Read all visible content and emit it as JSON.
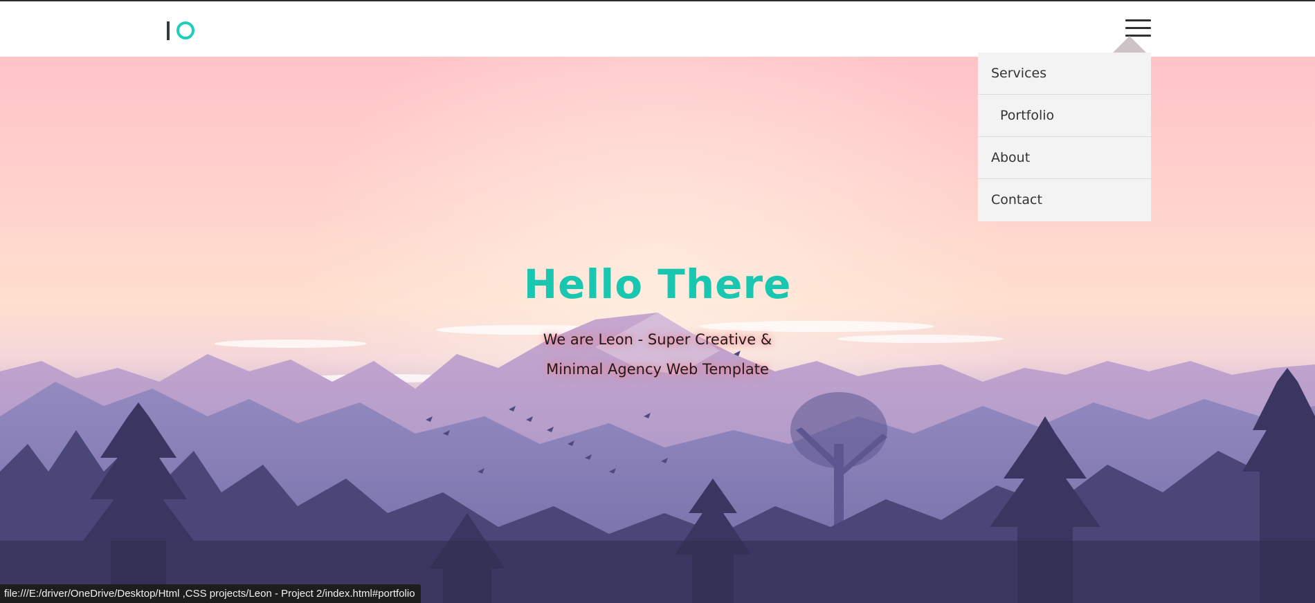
{
  "header": {
    "logo_alt": "IO"
  },
  "nav": {
    "menu_icon": "hamburger-menu-icon",
    "items": [
      {
        "label": "Services"
      },
      {
        "label": "Portfolio"
      },
      {
        "label": "About"
      },
      {
        "label": "Contact"
      }
    ]
  },
  "hero": {
    "title": "Hello There",
    "subtitle_line1": "We are Leon - Super Creative &",
    "subtitle_line2": "Minimal Agency Web Template"
  },
  "status_bar": {
    "url": "file:///E:/driver/OneDrive/Desktop/Html ,CSS projects/Leon - Project 2/index.html#portfolio"
  },
  "colors": {
    "accent": "#19c6b0",
    "logo_dark": "#2c3a46",
    "dropdown_bg": "#f3f3f3"
  }
}
